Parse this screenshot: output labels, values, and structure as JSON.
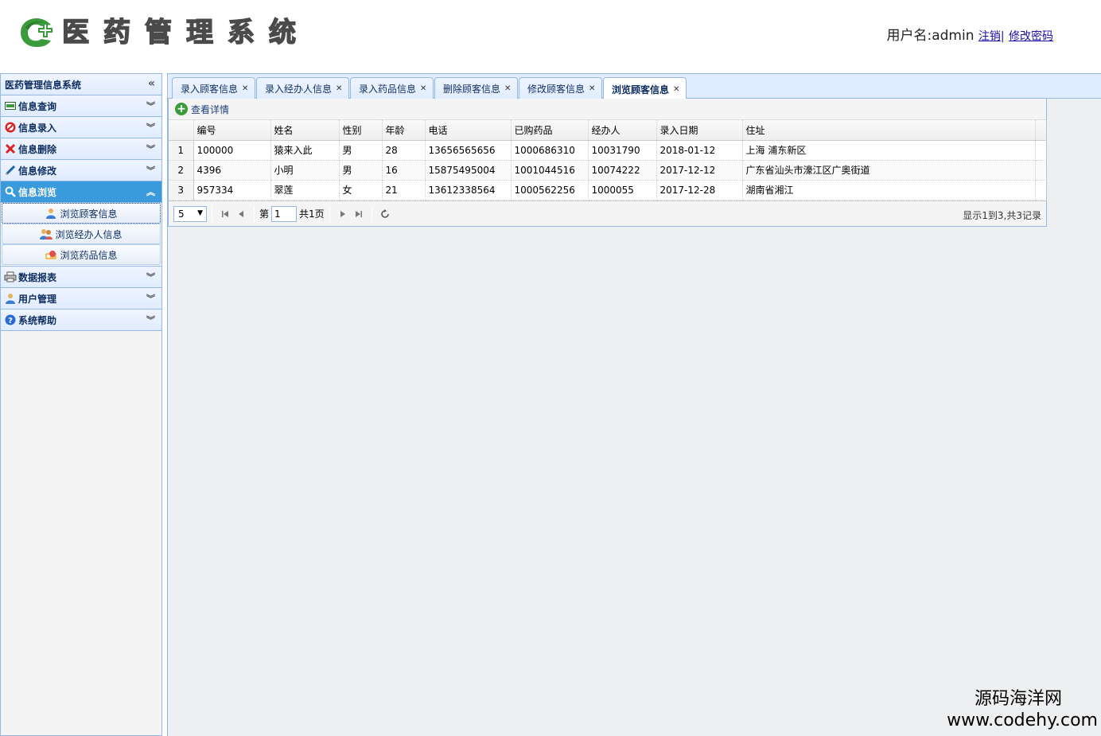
{
  "header": {
    "title": "医药管理系统",
    "user_label": "用户名:admin",
    "logout_label": "注销",
    "separator": "|",
    "change_password_label": "修改密码"
  },
  "sidebar": {
    "title": "医药管理信息系统",
    "collapse_glyph": "«",
    "items": [
      {
        "label": "信息查询",
        "icon": "card-icon"
      },
      {
        "label": "信息录入",
        "icon": "no-entry-icon"
      },
      {
        "label": "信息删除",
        "icon": "red-x-icon"
      },
      {
        "label": "信息修改",
        "icon": "pencil-icon"
      },
      {
        "label": "信息浏览",
        "icon": "magnifier-icon"
      },
      {
        "label": "数据报表",
        "icon": "printer-icon"
      },
      {
        "label": "用户管理",
        "icon": "user-icon"
      },
      {
        "label": "系统帮助",
        "icon": "help-icon"
      }
    ],
    "sub_items": [
      {
        "label": "浏览顾客信息"
      },
      {
        "label": "浏览经办人信息"
      },
      {
        "label": "浏览药品信息"
      }
    ]
  },
  "tabs": [
    {
      "label": "录入顾客信息"
    },
    {
      "label": "录入经办人信息"
    },
    {
      "label": "录入药品信息"
    },
    {
      "label": "删除顾客信息"
    },
    {
      "label": "修改顾客信息"
    },
    {
      "label": "浏览顾客信息"
    }
  ],
  "toolbar": {
    "view_detail_label": "查看详情"
  },
  "table": {
    "columns": [
      "编号",
      "姓名",
      "性别",
      "年龄",
      "电话",
      "已购药品",
      "经办人",
      "录入日期",
      "住址"
    ],
    "rows": [
      {
        "num": "1",
        "cells": [
          "100000",
          "猿来入此",
          "男",
          "28",
          "13656565656",
          "1000686310",
          "10031790",
          "2018-01-12",
          "上海 浦东新区"
        ]
      },
      {
        "num": "2",
        "cells": [
          "4396",
          "小明",
          "男",
          "16",
          "15875495004",
          "1001044516",
          "10074222",
          "2017-12-12",
          "广东省汕头市濠江区广奥街道"
        ]
      },
      {
        "num": "3",
        "cells": [
          "957334",
          "翠莲",
          "女",
          "21",
          "13612338564",
          "1000562256",
          "1000055",
          "2017-12-28",
          "湖南省湘江"
        ]
      }
    ]
  },
  "pager": {
    "page_size": "5",
    "page_prefix": "第",
    "page_value": "1",
    "page_total": "共1页",
    "info": "显示1到3,共3记录"
  },
  "watermark": {
    "line1": "源码海洋网",
    "line2": "www.codehy.com"
  },
  "colors": {
    "accent": "#3a9bdc",
    "border": "#95b8e7",
    "header_bg": "#e0ecff"
  }
}
